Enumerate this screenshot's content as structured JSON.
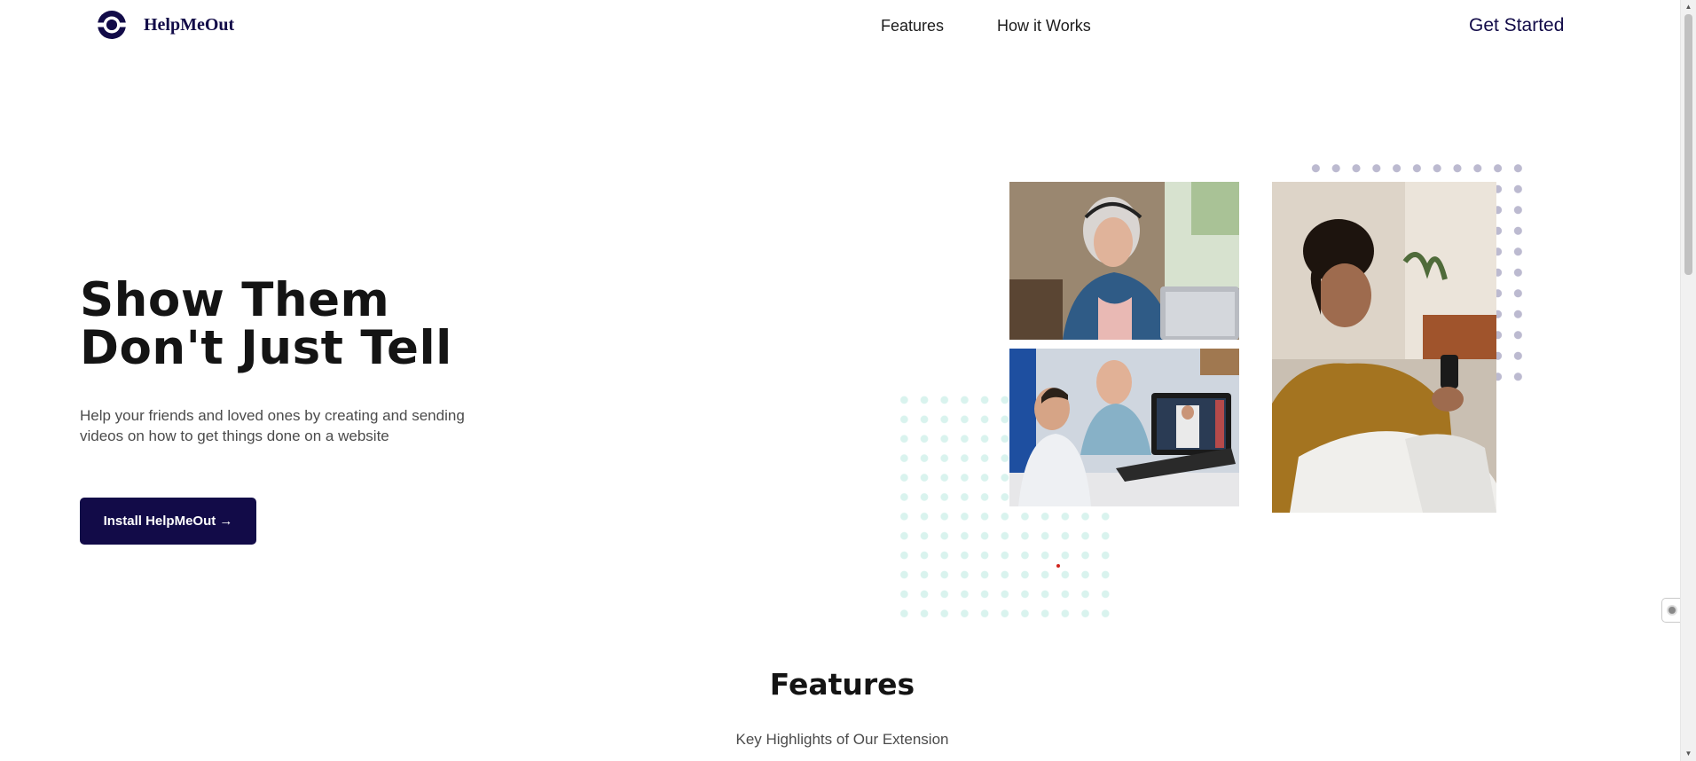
{
  "nav": {
    "logo_icon": "helpmeout-logo-icon",
    "logo_text": "HelpMeOut",
    "links": [
      {
        "label": "Features"
      },
      {
        "label": "How it Works"
      }
    ],
    "cta_label": "Get Started"
  },
  "hero": {
    "title_line1": "Show Them",
    "title_line2": "Don't Just Tell",
    "subtitle": "Help your friends and loved ones by creating and sending videos on how to get things done on a website",
    "button_label": "Install HelpMeOut →",
    "images": [
      {
        "icon": "photo-woman-headphones-laptop"
      },
      {
        "icon": "photo-man-and-boy-video-call"
      },
      {
        "icon": "photo-woman-smiling-phone"
      }
    ]
  },
  "features": {
    "title": "Features",
    "subtitle": "Key Highlights of Our Extension"
  },
  "colors": {
    "brand": "#120b48",
    "mint_dots": "#d9f3ee",
    "grey_dots": "#bcbad0",
    "text_dark": "#141414",
    "text_muted": "#4b4b4b"
  }
}
